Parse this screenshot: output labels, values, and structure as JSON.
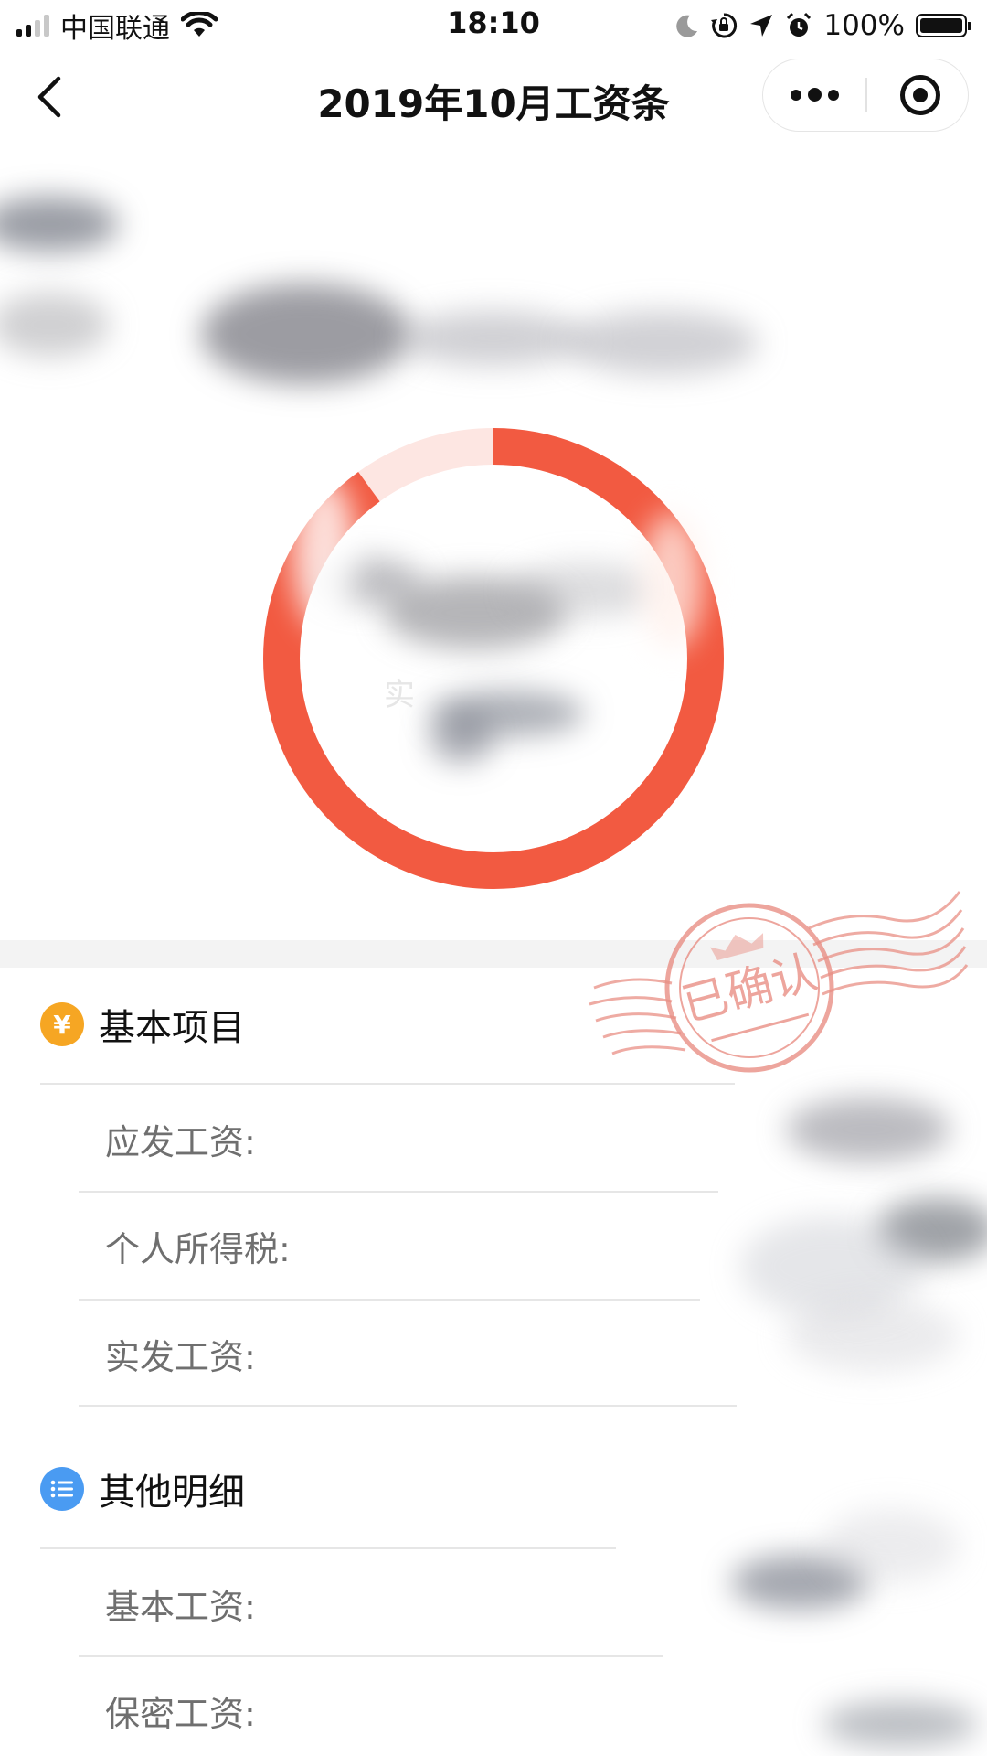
{
  "status_bar": {
    "carrier": "中国联通",
    "time": "18:10",
    "battery_percent": "100%",
    "battery_level": 1.0,
    "icons": [
      "signal-icon",
      "wifi-icon",
      "moon-icon",
      "rotation-lock-icon",
      "location-arrow-icon",
      "alarm-icon",
      "battery-icon"
    ]
  },
  "nav": {
    "title": "2019年10月工资条",
    "icons": [
      "back-chevron-icon",
      "more-dots-icon",
      "target-circle-icon"
    ]
  },
  "summary": {
    "donut_fraction_highlighted": 0.9,
    "label_partial": "实"
  },
  "stamp": {
    "text": "已确认"
  },
  "sections": [
    {
      "title": "基本项目",
      "icon": "yen-icon",
      "icon_glyph": "¥",
      "rows": [
        {
          "label": "应发工资:"
        },
        {
          "label": "个人所得税:"
        },
        {
          "label": "实发工资:"
        }
      ]
    },
    {
      "title": "其他明细",
      "icon": "list-icon",
      "rows": [
        {
          "label": "基本工资:"
        },
        {
          "label": "保密工资:"
        }
      ]
    }
  ],
  "colors": {
    "accent_red": "#f25a41",
    "accent_red_light": "#fde6e2",
    "yen_icon_bg": "#f6a623",
    "list_icon_bg": "#4a9bf2",
    "stamp_red": "#e98f85",
    "separator_gray": "#f3f3f3"
  }
}
